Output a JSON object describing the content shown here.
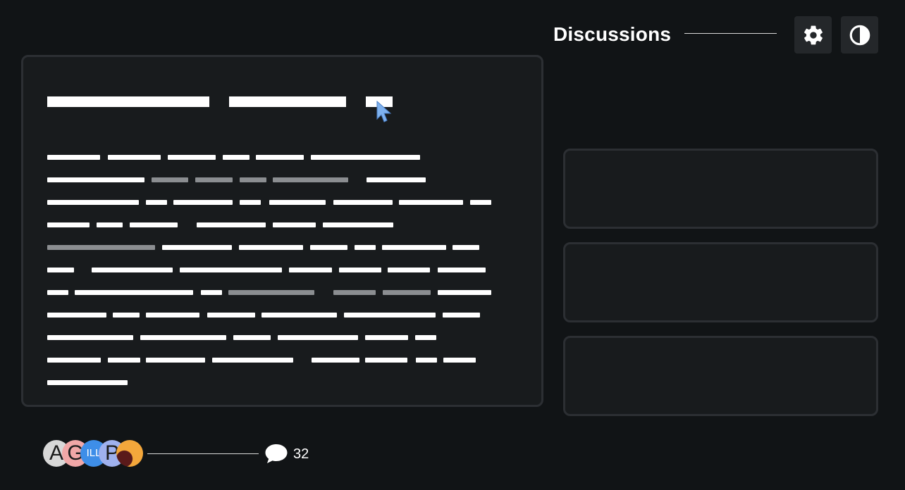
{
  "header": {
    "title": "Discussions",
    "settings_icon": "gear-icon",
    "theme_icon": "contrast-icon"
  },
  "main_card": {
    "heading_placeholder": "title text (redacted placeholder bars)",
    "body_placeholder": "paragraph text (redacted placeholder bars)"
  },
  "side_cards": {
    "count": 3
  },
  "footer": {
    "avatars": [
      {
        "initial": "A",
        "color": "#d8d8d8"
      },
      {
        "initial": "G",
        "color": "#f1a7a7"
      },
      {
        "initial": "ILL",
        "color": "#3e8ee8"
      },
      {
        "initial": "P",
        "color": "#9fb1ee"
      },
      {
        "initial": "",
        "color": "#f4a73b"
      }
    ],
    "comment_icon": "speech-bubble-icon",
    "comment_count": "32"
  },
  "colors": {
    "background": "#111416",
    "card": "#181b1d",
    "border": "#2c2f33",
    "accent_cursor": "#7eb1ee",
    "muted_text": "#8b8e91"
  }
}
